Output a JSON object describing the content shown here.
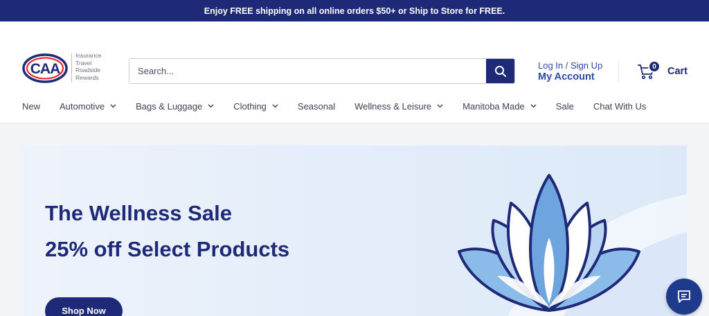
{
  "announcement": {
    "text": "Enjoy FREE shipping on all online orders $50+ or Ship to Store for FREE."
  },
  "logo": {
    "brand_icon": "caa-logo",
    "taglines": [
      "Insurance",
      "Travel",
      "Roadside",
      "Rewards"
    ]
  },
  "search": {
    "placeholder": "Search...",
    "button_icon": "search-icon"
  },
  "account": {
    "top_label": "Log In / Sign Up",
    "main_label": "My Account"
  },
  "cart": {
    "count": "0",
    "label": "Cart",
    "icon": "cart-icon"
  },
  "nav": {
    "items": [
      {
        "label": "New",
        "has_dropdown": false
      },
      {
        "label": "Automotive",
        "has_dropdown": true
      },
      {
        "label": "Bags & Luggage",
        "has_dropdown": true
      },
      {
        "label": "Clothing",
        "has_dropdown": true
      },
      {
        "label": "Seasonal",
        "has_dropdown": false
      },
      {
        "label": "Wellness & Leisure",
        "has_dropdown": true
      },
      {
        "label": "Manitoba Made",
        "has_dropdown": true
      },
      {
        "label": "Sale",
        "has_dropdown": false
      },
      {
        "label": "Chat With Us",
        "has_dropdown": false
      }
    ]
  },
  "banner": {
    "title": "The Wellness Sale",
    "subtitle": "25% off Select Products",
    "cta_label": "Shop Now",
    "image_icon": "lotus-icon"
  },
  "chat": {
    "icon": "chat-icon"
  },
  "colors": {
    "brand_navy": "#1e2a78",
    "link_blue": "#2d4ba8",
    "caa_red": "#e31b23",
    "lotus_blue": "#7fb3e6"
  }
}
